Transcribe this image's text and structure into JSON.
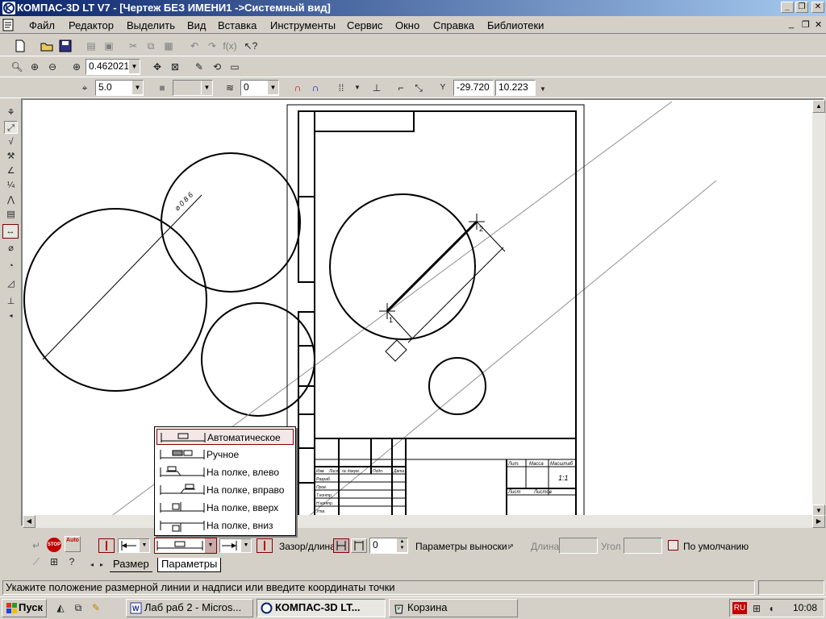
{
  "window": {
    "title": "КОМПАС-3D LT V7 - [Чертеж БЕЗ ИМЕНИ1 ->Системный вид]",
    "minimize": "_",
    "restore": "❐",
    "close": "✕"
  },
  "menu": [
    "Файл",
    "Редактор",
    "Выделить",
    "Вид",
    "Вставка",
    "Инструменты",
    "Сервис",
    "Окно",
    "Справка",
    "Библиотеки"
  ],
  "mdi_controls": {
    "minimize": "_",
    "restore": "❐",
    "close": "✕"
  },
  "view_toolbar": {
    "zoom_value": "0.462021"
  },
  "current_toolbar": {
    "step_value": "5.0",
    "layer_value": "0",
    "x_coord": "-29.720",
    "y_coord": "10.223",
    "coord_label": "Y"
  },
  "drawing": {
    "dimension_text": "⌀ 0 8 6",
    "point_1": "1",
    "point_2": "2",
    "stamp_labels": [
      "Лит.",
      "Масса",
      "Масштаб",
      "Лист",
      "Листов",
      "Изм.",
      "Лист",
      "№ докум.",
      "Подп.",
      "Дата",
      "Разраб.",
      "Пров.",
      "Т.контр.",
      "Н.контр.",
      "Утв."
    ],
    "sheet_scale": "1:1"
  },
  "popup": {
    "items": [
      {
        "label": "Автоматическое",
        "selected": true
      },
      {
        "label": "Ручное",
        "selected": false
      },
      {
        "label": "На полке, влево",
        "selected": false
      },
      {
        "label": "На полке, вправо",
        "selected": false
      },
      {
        "label": "На полке, вверх",
        "selected": false
      },
      {
        "label": "На полке, вниз",
        "selected": false
      }
    ]
  },
  "propbar": {
    "auto_label": "Auto",
    "stop_label": "STOP",
    "gap_label": "Зазор/длина",
    "gap_value": "0",
    "extension_params_label": "Параметры выноски",
    "length_label": "Длина",
    "angle_label": "Угол",
    "default_label": "По умолчанию",
    "tabs": [
      "Размер",
      "Параметры"
    ],
    "active_tab": "Параметры"
  },
  "status": {
    "message": "Укажите положение размерной линии и надписи или введите координаты точки"
  },
  "taskbar": {
    "start_label": "Пуск",
    "tasks": [
      {
        "label": "Лаб раб 2 - Micros...",
        "active": false
      },
      {
        "label": "КОМПАС-3D LT...",
        "active": true
      },
      {
        "label": "Корзина",
        "active": false
      }
    ],
    "lang": "RU",
    "clock": "10:08"
  },
  "colors": {
    "title_start": "#0a246a",
    "title_end": "#a6caf0",
    "face": "#d4d0c8",
    "selection_border": "#800000",
    "lang_badge": "#c00000"
  }
}
